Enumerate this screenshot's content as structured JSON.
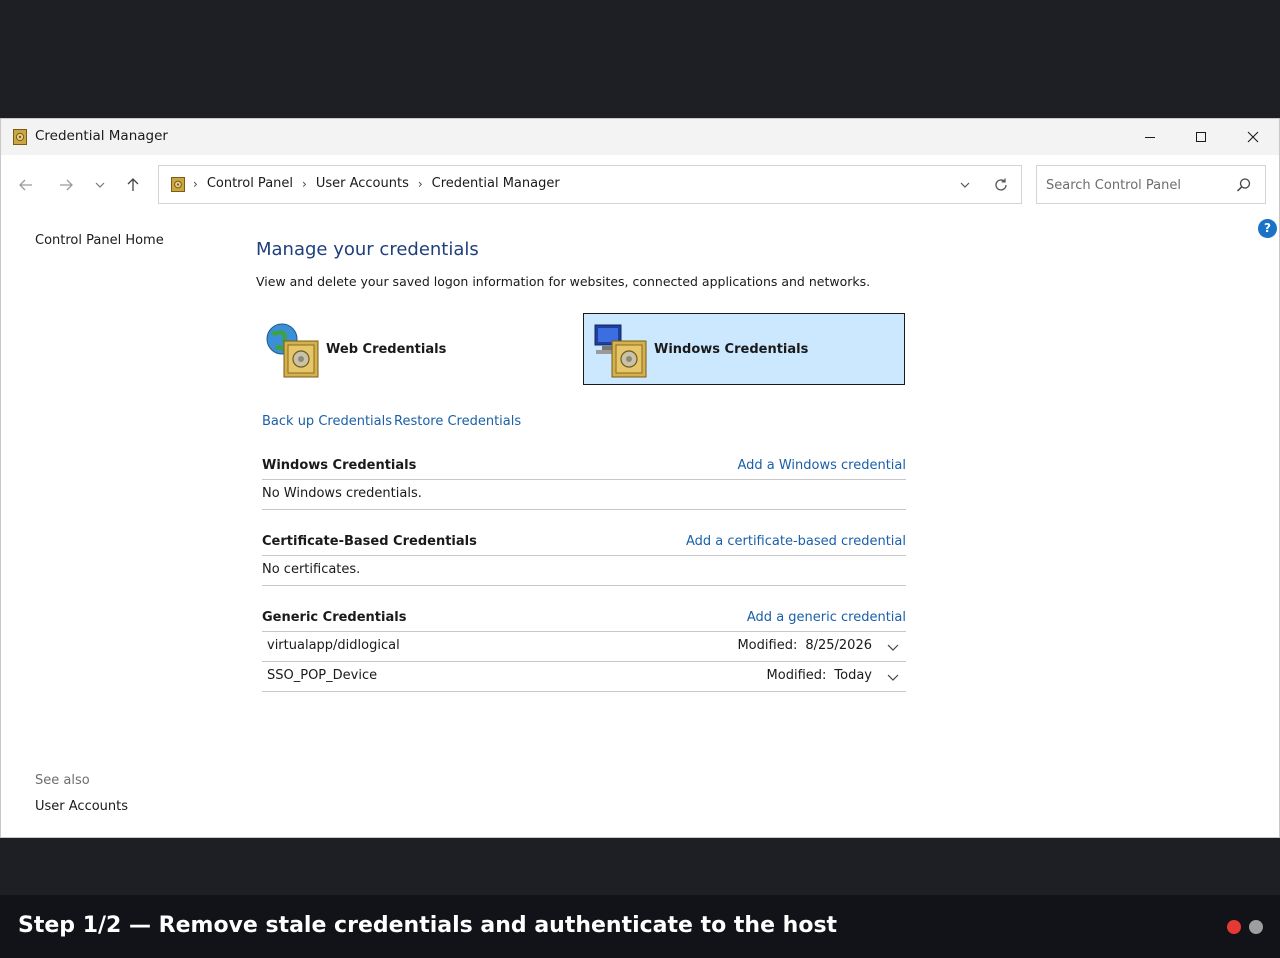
{
  "window": {
    "title": "Credential Manager",
    "app_icon": "vault-icon",
    "controls": [
      "minimize-icon",
      "maximize-icon",
      "close-icon"
    ]
  },
  "address_bar": {
    "crumbs": [
      "Control Panel",
      "User Accounts",
      "Credential Manager"
    ],
    "separator": "›",
    "search_placeholder": "Search Control Panel"
  },
  "help_label": "?",
  "sidebar": {
    "home": "Control Panel Home",
    "see_also": "See also",
    "see_also_links": [
      "User Accounts"
    ]
  },
  "main": {
    "title": "Manage your credentials",
    "description": "View and delete your saved logon information for websites, connected applications and networks.",
    "tiles": [
      {
        "label": "Web Credentials",
        "icon": "globe-vault-icon",
        "selected": false
      },
      {
        "label": "Windows Credentials",
        "icon": "computer-vault-icon",
        "selected": true
      }
    ],
    "actions": {
      "backup": "Back up Credentials",
      "restore": "Restore Credentials"
    },
    "sections": {
      "windows": {
        "title": "Windows Credentials",
        "add": "Add a Windows credential",
        "empty": "No Windows credentials."
      },
      "certificate": {
        "title": "Certificate-Based Credentials",
        "add": "Add a certificate-based credential",
        "empty": "No certificates."
      },
      "generic": {
        "title": "Generic Credentials",
        "add": "Add a generic credential",
        "entries": [
          {
            "name": "virtualapp/didlogical",
            "modified_label": "Modified:",
            "modified": "8/25/2026"
          },
          {
            "name": "SSO_POP_Device",
            "modified_label": "Modified:",
            "modified": "Today"
          }
        ]
      }
    }
  },
  "banner": {
    "text": "Step 1/2 — Remove stale credentials and authenticate to the host",
    "indicators": [
      {
        "color": "#e53935",
        "active": true
      },
      {
        "color": "#9e9e9e",
        "active": false
      }
    ]
  },
  "colors": {
    "link": "#1a5fa8",
    "title": "#1e3f7a",
    "tile_selected_bg": "#cce8ff",
    "help": "#1a73c7",
    "backdrop": "#1e1f24"
  }
}
